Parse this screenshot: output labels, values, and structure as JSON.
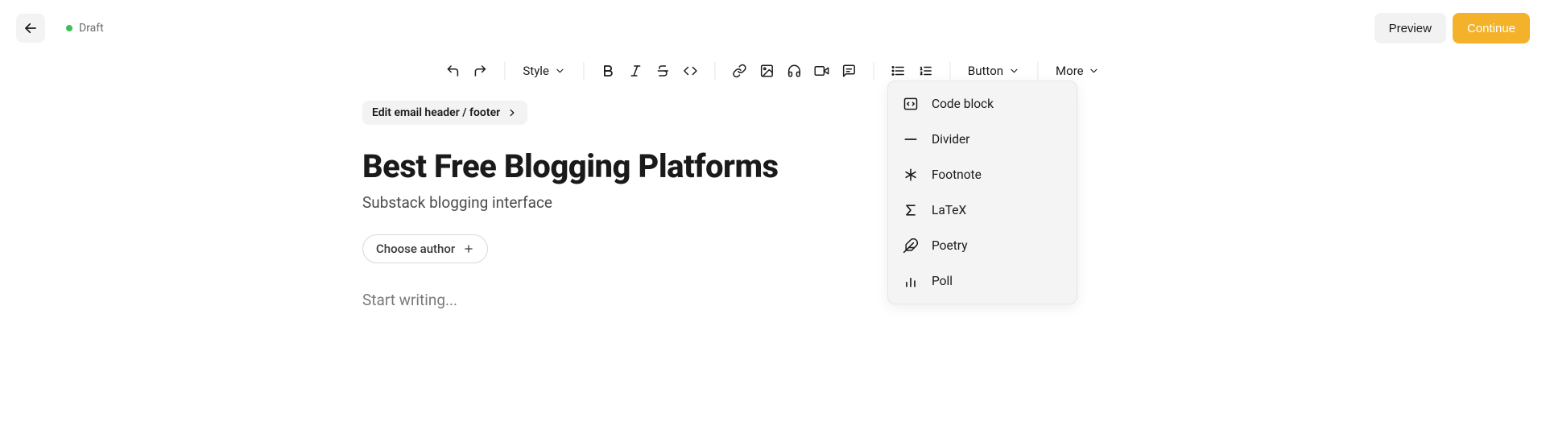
{
  "status": {
    "label": "Draft"
  },
  "top_actions": {
    "preview": "Preview",
    "continue": "Continue"
  },
  "toolbar": {
    "style_label": "Style",
    "button_label": "Button",
    "more_label": "More"
  },
  "more_menu": {
    "items": [
      {
        "label": "Code block"
      },
      {
        "label": "Divider"
      },
      {
        "label": "Footnote"
      },
      {
        "label": "LaTeX"
      },
      {
        "label": "Poetry"
      },
      {
        "label": "Poll"
      }
    ]
  },
  "email_header_btn": "Edit email header / footer",
  "post": {
    "title": "Best Free Blogging Platforms",
    "subtitle": "Substack blogging interface",
    "body_placeholder": "Start writing..."
  },
  "author": {
    "choose_label": "Choose author"
  }
}
